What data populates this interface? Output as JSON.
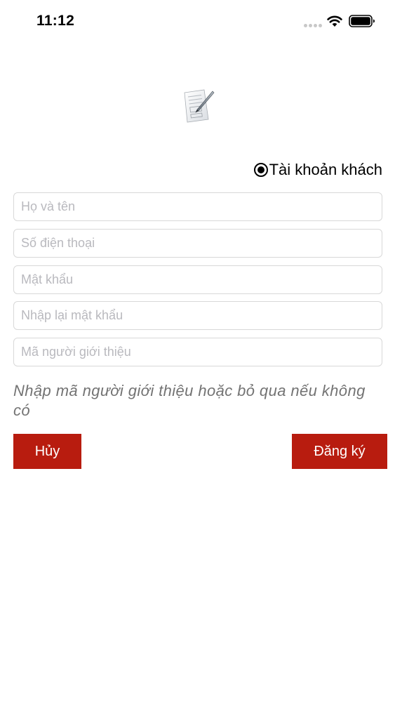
{
  "status_bar": {
    "time": "11:12"
  },
  "account_type": {
    "label": "Tài khoản khách",
    "selected": true
  },
  "form": {
    "full_name": {
      "placeholder": "Họ và tên",
      "value": ""
    },
    "phone": {
      "placeholder": "Số điện thoại",
      "value": ""
    },
    "password": {
      "placeholder": "Mật khẩu",
      "value": ""
    },
    "confirm_password": {
      "placeholder": "Nhập lại mật khẩu",
      "value": ""
    },
    "referral_code": {
      "placeholder": "Mã người giới thiệu",
      "value": ""
    }
  },
  "hint": {
    "text": "Nhập mã người giới thiệu hoặc bỏ qua nếu không có"
  },
  "actions": {
    "cancel_label": "Hủy",
    "register_label": "Đăng ký"
  },
  "colors": {
    "button_bg": "#b81c0f",
    "button_text": "#ffffff",
    "hint_text": "#737373",
    "field_border": "#d8d8d8",
    "placeholder": "#b9b9be"
  },
  "icons": {
    "logo": "form-pen-icon",
    "radio": "radio-selected-icon",
    "status": [
      "cellular-signal-icon",
      "wifi-icon",
      "battery-icon"
    ]
  }
}
